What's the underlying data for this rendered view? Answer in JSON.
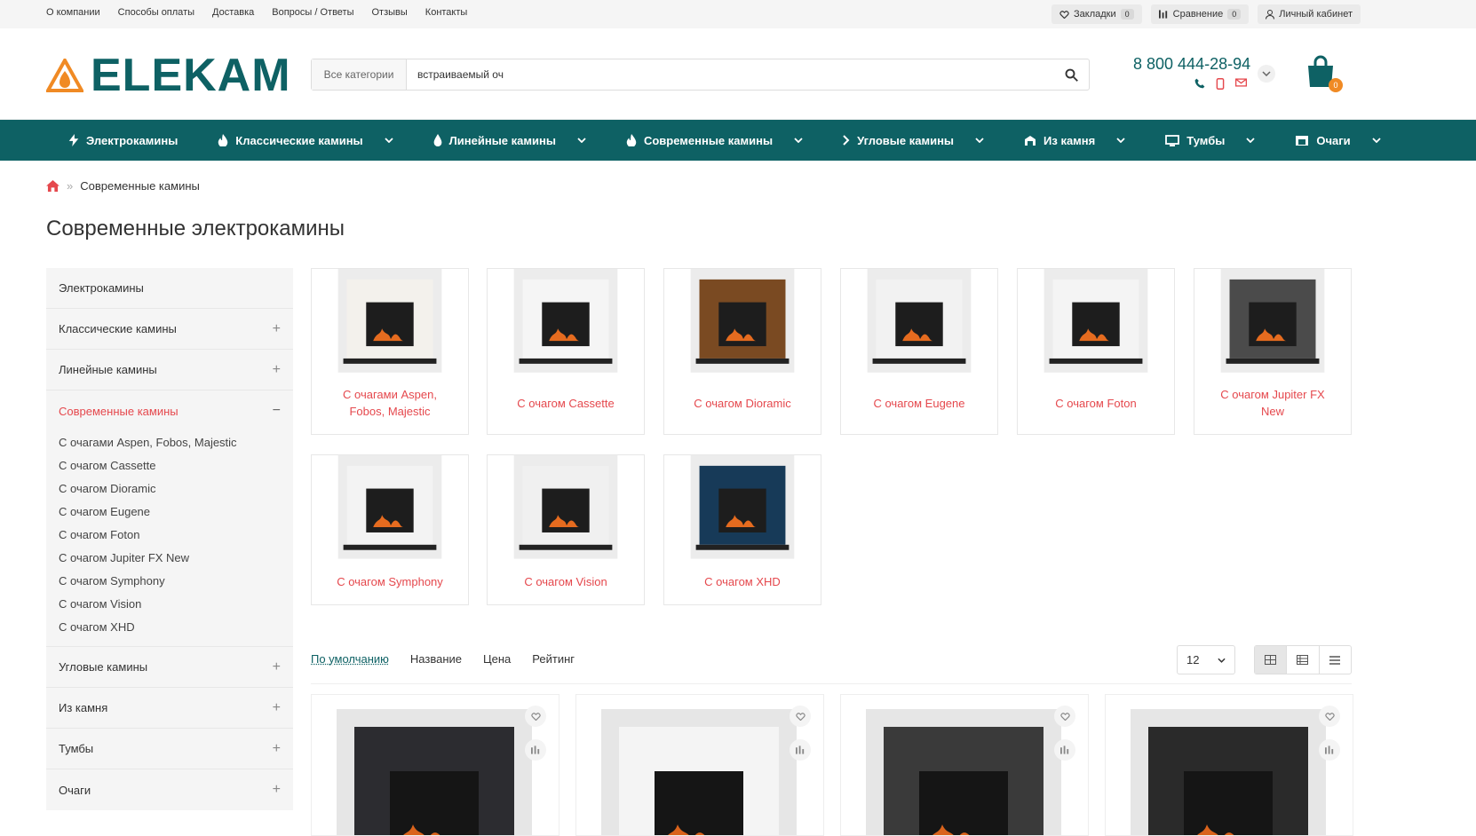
{
  "topbar": {
    "links": [
      "О компании",
      "Способы оплаты",
      "Доставка",
      "Вопросы / Ответы",
      "Отзывы",
      "Контакты"
    ],
    "bookmarks_label": "Закладки",
    "bookmarks_count": "0",
    "compare_label": "Сравнение",
    "compare_count": "0",
    "account_label": "Личный кабинет"
  },
  "header": {
    "logo_text": "ELEKAM",
    "search_category": "Все категории",
    "search_value": "встраиваемый оч",
    "phone": "8 800 444-28-94",
    "cart_count": "0"
  },
  "nav": {
    "items": [
      {
        "label": "Электрокамины",
        "icon": "bolt-icon"
      },
      {
        "label": "Классические камины",
        "icon": "fire-icon"
      },
      {
        "label": "Линейные камины",
        "icon": "drop-icon"
      },
      {
        "label": "Современные камины",
        "icon": "flame-icon"
      },
      {
        "label": "Угловые камины",
        "icon": "chevron-right-icon"
      },
      {
        "label": "Из камня",
        "icon": "stone-icon"
      },
      {
        "label": "Тумбы",
        "icon": "monitor-icon"
      },
      {
        "label": "Очаги",
        "icon": "hearth-icon"
      }
    ]
  },
  "breadcrumb": {
    "current": "Современные камины"
  },
  "page_title": "Современные электрокамины",
  "sidebar": {
    "items": [
      {
        "label": "Электрокамины",
        "expandable": false
      },
      {
        "label": "Классические камины",
        "expandable": true
      },
      {
        "label": "Линейные камины",
        "expandable": true
      },
      {
        "label": "Современные камины",
        "expandable": true,
        "active": true
      },
      {
        "label": "Угловые камины",
        "expandable": true
      },
      {
        "label": "Из камня",
        "expandable": true
      },
      {
        "label": "Тумбы",
        "expandable": true
      },
      {
        "label": "Очаги",
        "expandable": true
      }
    ],
    "subitems": [
      "С очагами Aspen, Fobos, Majestic",
      "С очагом Cassette",
      "С очагом Dioramic",
      "С очагом Eugene",
      "С очагом Foton",
      "С очагом Jupiter FX New",
      "С очагом Symphony",
      "С очагом Vision",
      "С очагом XHD"
    ]
  },
  "categories": [
    {
      "label": "С очагами Aspen, Fobos, Majestic",
      "frame": "#f3f1ec"
    },
    {
      "label": "С очагом Cassette",
      "frame": "#f5f5f5"
    },
    {
      "label": "С очагом Dioramic",
      "frame": "#7a4a22"
    },
    {
      "label": "С очагом Eugene",
      "frame": "#f2f2f2"
    },
    {
      "label": "С очагом Foton",
      "frame": "#f4f4f4"
    },
    {
      "label": "С очагом Jupiter FX New",
      "frame": "#4b4b4b"
    },
    {
      "label": "С очагом Symphony",
      "frame": "#f3f3f3"
    },
    {
      "label": "С очагом Vision",
      "frame": "#f0f0f0"
    },
    {
      "label": "С очагом XHD",
      "frame": "#173a58"
    }
  ],
  "sorting": {
    "options": [
      "По умолчанию",
      "Название",
      "Цена",
      "Рейтинг"
    ],
    "per_page": "12"
  },
  "products_count": 4,
  "colors": {
    "brand": "#0e6164",
    "accent": "#e5484d",
    "cart_badge": "#f08a24"
  }
}
